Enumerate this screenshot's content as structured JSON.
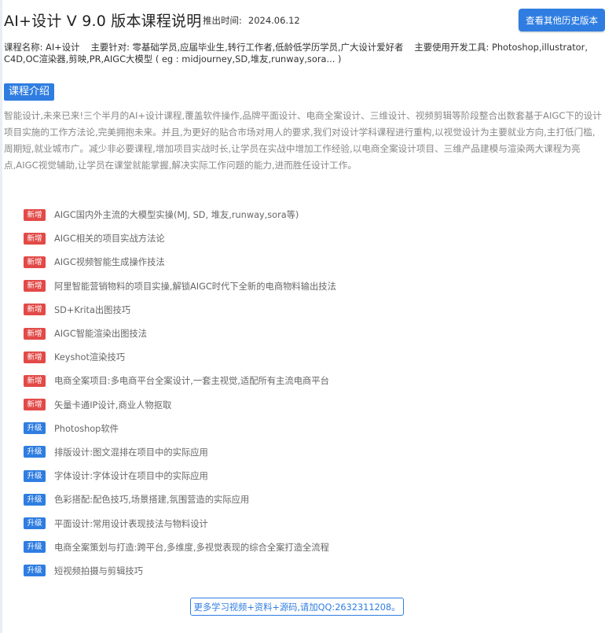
{
  "header": {
    "title": "AI+设计 V 9.0 版本课程说明",
    "release_label": "推出时间:",
    "release_date": "2024.06.12",
    "history_button": "查看其他历史版本"
  },
  "meta": {
    "course_name_label": "课程名称:",
    "course_name": "AI+设计",
    "audience_label": "主要针对:",
    "audience": "零基础学员,应届毕业生,转行工作者,低龄低学历学员,广大设计爱好者",
    "tools_label": "主要使用开发工具:",
    "tools": "Photoshop,illustrator, C4D,OC渲染器,剪映,PR,AIGC大模型 ( eg : midjourney,SD,堆友,runway,sora... )"
  },
  "section": {
    "title": "课程介绍"
  },
  "intro": "智能设计,未来已来!三个半月的AI+设计课程,覆盖软件操作,品牌平面设计、电商全案设计、三维设计、视频剪辑等阶段整合出数套基于AIGC下的设计项目实施的工作方法论,完美拥抱未来。并且,为更好的贴合市场对用人的要求,我们对设计学科课程进行重构,以视觉设计为主要就业方向,主打低门槛,周期短,就业城市广。减少非必要课程,增加项目实战时长,让学员在实战中增加工作经验,以电商全案设计项目、三维产品建模与渲染两大课程为亮点,AIGC视觉辅助,让学员在课堂就能掌握,解决实际工作问题的能力,进而胜任设计工作。",
  "tags": {
    "new": "新增",
    "upgrade": "升级"
  },
  "features": [
    {
      "type": "new",
      "text": "AIGC国内外主流的大模型实操(MJ, SD, 堆友,runway,sora等)"
    },
    {
      "type": "new",
      "text": "AIGC相关的项目实战方法论"
    },
    {
      "type": "new",
      "text": "AIGC视频智能生成操作技法"
    },
    {
      "type": "new",
      "text": "阿里智能营销物料的项目实操,解锁AIGC时代下全新的电商物料输出技法"
    },
    {
      "type": "new",
      "text": "SD+Krita出图技巧"
    },
    {
      "type": "new",
      "text": "AIGC智能渲染出图技法"
    },
    {
      "type": "new",
      "text": "Keyshot渲染技巧"
    },
    {
      "type": "new",
      "text": "电商全案项目:多电商平台全案设计,一套主视觉,适配所有主流电商平台"
    },
    {
      "type": "new",
      "text": "矢量卡通IP设计,商业人物抠取"
    },
    {
      "type": "upgrade",
      "text": "Photoshop软件"
    },
    {
      "type": "upgrade",
      "text": "排版设计:图文混排在项目中的实际应用"
    },
    {
      "type": "upgrade",
      "text": "字体设计:字体设计在项目中的实际应用"
    },
    {
      "type": "upgrade",
      "text": "色彩搭配:配色技巧,场景搭建,氛围营造的实际应用"
    },
    {
      "type": "upgrade",
      "text": "平面设计:常用设计表现技法与物料设计"
    },
    {
      "type": "upgrade",
      "text": "电商全案策划与打造:跨平台,多维度,多视觉表现的综合全案打造全流程"
    },
    {
      "type": "upgrade",
      "text": "短视频拍摄与剪辑技巧"
    }
  ],
  "footer": {
    "more_link": "更多学习视频+资料+源码,请加QQ:2632311208。"
  },
  "colors": {
    "accent": "#2f7de1",
    "new_tag": "#e24a47",
    "upgrade_tag": "#2f7de1"
  }
}
